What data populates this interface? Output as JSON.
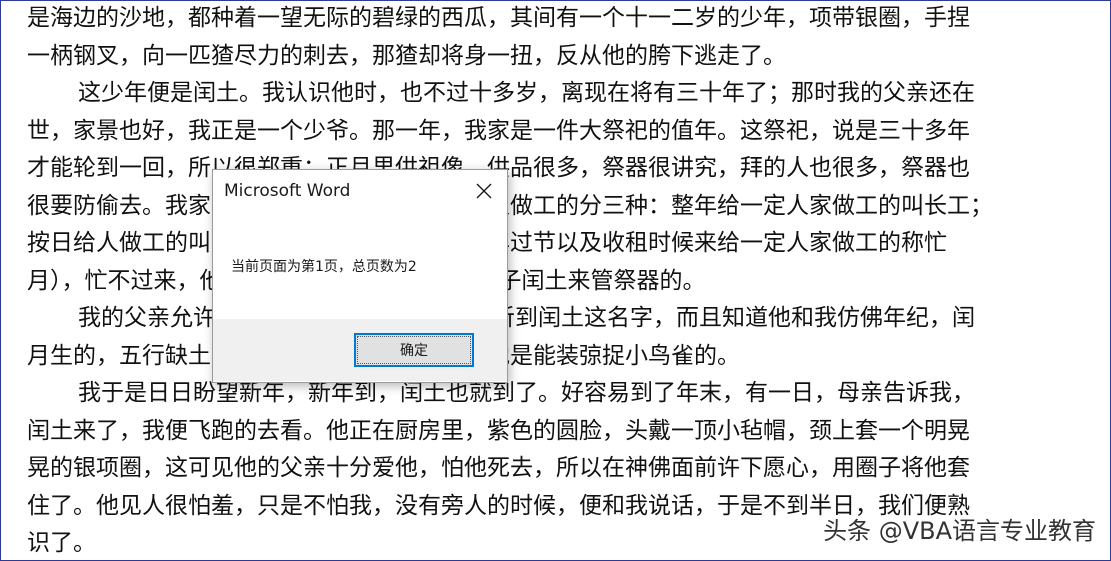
{
  "document": {
    "lines": [
      {
        "text": "是海边的沙地，都种着一望无际的碧绿的西瓜，其间有一个十一二岁的少年，项带银圈，手捏",
        "indent": false
      },
      {
        "text": "一柄钢叉，向一匹猹尽力的刺去，那猹却将身一扭，反从他的胯下逃走了。",
        "indent": false
      },
      {
        "text": "这少年便是闰土。我认识他时，也不过十多岁，离现在将有三十年了；那时我的父亲还在",
        "indent": true
      },
      {
        "text": "世，家景也好，我正是一个少爷。那一年，我家是一件大祭祀的值年。这祭祀，说是三十多年",
        "indent": false
      },
      {
        "text": "才能轮到一回，所以很郑重；正月里供祖像，供品很多，祭器很讲究，拜的人也很多，祭器也",
        "indent": false
      },
      {
        "text": "很要防偷去。我家只有一个忙月（我们这里给人做工的分三种：整年给一定人家做工的叫长工；",
        "indent": false
      },
      {
        "text": "按日给人做工的叫短工；自己也种地，只在过年过节以及收租时候来给一定人家做工的称忙",
        "indent": false
      },
      {
        "text": "月），忙不过来，他便对父亲说，可以叫他的儿子闰土来管祭器的。",
        "indent": false
      },
      {
        "text": "我的父亲允许了；我也很高兴，因为我早听到闰土这名字，而且知道他和我仿佛年纪，闰",
        "indent": true
      },
      {
        "text": "月生的，五行缺土，所以他的父亲叫他闰土。他是能装弶捉小鸟雀的。",
        "indent": false
      },
      {
        "text": "我于是日日盼望新年，新年到，闰土也就到了。好容易到了年末，有一日，母亲告诉我，",
        "indent": true
      },
      {
        "text": "闰土来了，我便飞跑的去看。他正在厨房里，紫色的圆脸，头戴一顶小毡帽，颈上套一个明晃",
        "indent": false
      },
      {
        "text": "晃的银项圈，这可见他的父亲十分爱他，怕他死去，所以在神佛面前许下愿心，用圈子将他套",
        "indent": false
      },
      {
        "text": "住了。他见人很怕羞，只是不怕我，没有旁人的时候，便和我说话，于是不到半日，我们便熟",
        "indent": false
      },
      {
        "text": "识了。",
        "indent": false
      }
    ]
  },
  "dialog": {
    "title": "Microsoft Word",
    "message": "当前页面为第1页，总页数为2",
    "ok_label": "确定",
    "close_icon": "close-icon"
  },
  "watermark": {
    "text": "头条 @VBA语言专业教育"
  }
}
